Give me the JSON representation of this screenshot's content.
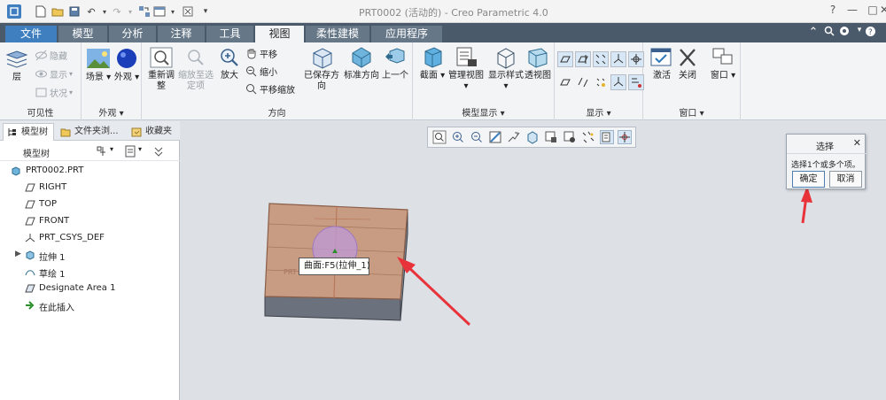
{
  "window": {
    "title": "PRT0002 (活动的) - Creo Parametric 4.0",
    "controls": [
      "?",
      "—",
      "□",
      "✕"
    ]
  },
  "ribbon_tabs": [
    "文件",
    "模型",
    "分析",
    "注释",
    "工具",
    "视图",
    "柔性建模",
    "应用程序"
  ],
  "ribbon": {
    "visibility": {
      "label": "可见性",
      "layer": "层",
      "hide": "隐藏",
      "show": "显示",
      "status": "状况"
    },
    "appearance": {
      "label": "外观",
      "scene": "场景",
      "appearance": "外观"
    },
    "orientation": {
      "label": "方向",
      "refit": "重新调整",
      "zoom_to_selected": "缩放至选定项",
      "zoom_in": "放大",
      "pan": "平移",
      "zoom_out": "缩小",
      "pan_zoom": "平移缩放",
      "saved_orientations": "已保存方向",
      "standard_orientation": "标准方向",
      "previous": "上一个"
    },
    "model_display": {
      "label": "模型显示",
      "section": "截面",
      "manage_views": "管理视图",
      "display_style": "显示样式",
      "perspective": "透视图"
    },
    "show": {
      "label": "显示"
    },
    "window": {
      "label": "窗口",
      "activate": "激活",
      "close": "关闭",
      "windows": "窗口"
    }
  },
  "panel": {
    "tabs": [
      "模型树",
      "文件夹浏...",
      "收藏夹"
    ],
    "tree_title": "模型树",
    "items": [
      {
        "label": "PRT0002.PRT",
        "icon": "part-icon"
      },
      {
        "label": "RIGHT",
        "icon": "datum-plane-icon"
      },
      {
        "label": "TOP",
        "icon": "datum-plane-icon"
      },
      {
        "label": "FRONT",
        "icon": "datum-plane-icon"
      },
      {
        "label": "PRT_CSYS_DEF",
        "icon": "csys-icon"
      },
      {
        "label": "拉伸 1",
        "icon": "extrude-icon"
      },
      {
        "label": "草绘 1",
        "icon": "sketch-icon"
      },
      {
        "label": "Designate Area 1",
        "icon": "area-icon"
      },
      {
        "label": "在此插入",
        "icon": "insert-here-icon"
      }
    ]
  },
  "viewport": {
    "tooltip": "曲面:F5(拉伸_1)",
    "model_text": "PRT"
  },
  "dialog": {
    "title": "选择",
    "message": "选择1个或多个项。",
    "ok": "确定",
    "cancel": "取消"
  },
  "colors": {
    "accent": "#3f7fbf",
    "annotation_arrow": "#e8333a",
    "model_top": "#c79a82",
    "model_side": "#6d7480"
  }
}
